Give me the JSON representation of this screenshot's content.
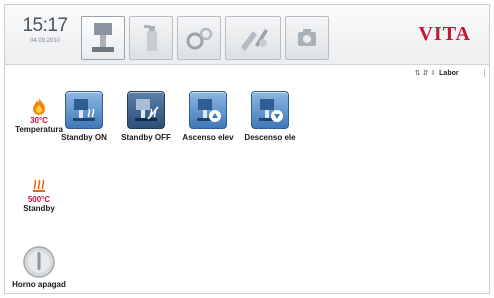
{
  "header": {
    "time": "15:17",
    "date": "04.09.2010",
    "brand": "VITA",
    "tabs": [
      {
        "name": "furnace",
        "icon": "furnace-icon"
      },
      {
        "name": "spray",
        "icon": "spray-bottle-icon"
      },
      {
        "name": "settings",
        "icon": "gears-icon"
      },
      {
        "name": "tools",
        "icon": "tools-icon"
      },
      {
        "name": "camera",
        "icon": "camera-icon"
      }
    ]
  },
  "status": {
    "indicators": "⇅ ⇵ ⇩",
    "mode": "Labor"
  },
  "left": {
    "temperature": {
      "value": "30°C",
      "label": "Temperatura"
    },
    "standby": {
      "value": "500°C",
      "label": "Standby"
    },
    "power": {
      "label": "Horno apagad"
    }
  },
  "actions": [
    {
      "label": "Standby ON",
      "icon": "standby-on-icon"
    },
    {
      "label": "Standby OFF",
      "icon": "standby-off-icon"
    },
    {
      "label": "Ascenso elev",
      "icon": "lift-up-icon"
    },
    {
      "label": "Descenso ele",
      "icon": "lift-down-icon"
    }
  ],
  "colors": {
    "accent": "#3e79b8",
    "brand": "#c2163a",
    "temperature": "#d0103a"
  }
}
